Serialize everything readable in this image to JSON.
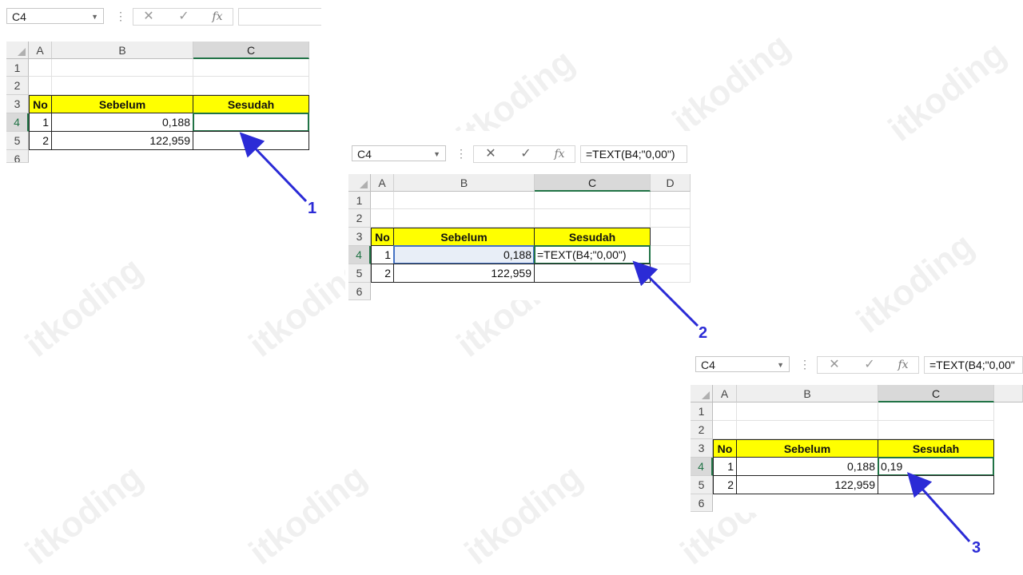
{
  "watermark": "itkoding",
  "steps": [
    "1",
    "2",
    "3"
  ],
  "panels": [
    {
      "name_box": "C4",
      "formula": "",
      "columns": [
        "A",
        "B",
        "C"
      ],
      "rows": [
        "1",
        "2",
        "3",
        "4",
        "5",
        "6"
      ],
      "header": {
        "no": "No",
        "before": "Sebelum",
        "after": "Sesudah"
      },
      "data": [
        {
          "no": "1",
          "before": "0,188",
          "after": ""
        },
        {
          "no": "2",
          "before": "122,959",
          "after": ""
        }
      ]
    },
    {
      "name_box": "C4",
      "formula": "=TEXT(B4;\"0,00\")",
      "columns": [
        "A",
        "B",
        "C",
        "D"
      ],
      "rows": [
        "1",
        "2",
        "3",
        "4",
        "5",
        "6"
      ],
      "header": {
        "no": "No",
        "before": "Sebelum",
        "after": "Sesudah"
      },
      "data": [
        {
          "no": "1",
          "before": "0,188",
          "after": "=TEXT(B4;\"0,00\")"
        },
        {
          "no": "2",
          "before": "122,959",
          "after": ""
        }
      ]
    },
    {
      "name_box": "C4",
      "formula": "=TEXT(B4;\"0,00\"",
      "columns": [
        "A",
        "B",
        "C"
      ],
      "rows": [
        "1",
        "2",
        "3",
        "4",
        "5",
        "6"
      ],
      "header": {
        "no": "No",
        "before": "Sebelum",
        "after": "Sesudah"
      },
      "data": [
        {
          "no": "1",
          "before": "0,188",
          "after": "0,19"
        },
        {
          "no": "2",
          "before": "122,959",
          "after": ""
        }
      ]
    }
  ],
  "colors": {
    "accent_green": "#217346",
    "header_yellow": "#ffff00",
    "arrow_blue": "#2b2bd6"
  }
}
